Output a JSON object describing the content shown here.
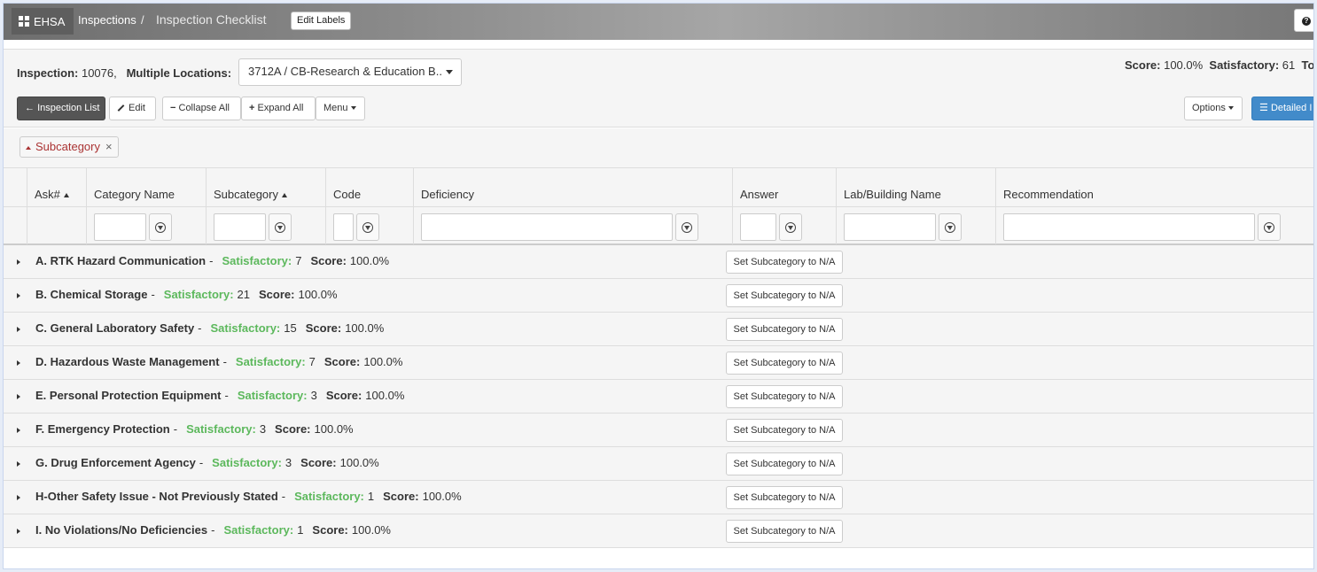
{
  "nav": {
    "brand": "EHSA",
    "breadcrumb_link": "Inspections",
    "breadcrumb_sep": "/",
    "breadcrumb_current": "Inspection Checklist",
    "edit_labels": "Edit Labels",
    "help_icon": "question-circle-icon"
  },
  "header": {
    "inspection_label": "Inspection:",
    "inspection_id": "10076,",
    "locations_label": "Multiple Locations:",
    "location_value": "3712A / CB-Research & Education B..",
    "score_label": "Score:",
    "score_value": "100.0%",
    "satisfactory_label": "Satisfactory:",
    "satisfactory_value": "61",
    "total_label": "Tot"
  },
  "toolbar": {
    "inspection_list": "Inspection List",
    "edit": "Edit",
    "collapse_all": "Collapse All",
    "expand_all": "Expand All",
    "menu": "Menu",
    "options": "Options",
    "detailed": "Detailed I"
  },
  "grouping": {
    "chip_label": "Subcategory",
    "remove": "×"
  },
  "columns": {
    "ask": "Ask#",
    "category": "Category Name",
    "subcategory": "Subcategory",
    "code": "Code",
    "deficiency": "Deficiency",
    "answer": "Answer",
    "lab": "Lab/Building Name",
    "recommendation": "Recommendation"
  },
  "groups": [
    {
      "name": "A. RTK Hazard Communication",
      "sat_label": "Satisfactory:",
      "sat": "7",
      "score_label": "Score:",
      "score": "100.0%",
      "button": "Set Subcategory to N/A"
    },
    {
      "name": "B. Chemical Storage",
      "sat_label": "Satisfactory:",
      "sat": "21",
      "score_label": "Score:",
      "score": "100.0%",
      "button": "Set Subcategory to N/A"
    },
    {
      "name": "C. General Laboratory Safety",
      "sat_label": "Satisfactory:",
      "sat": "15",
      "score_label": "Score:",
      "score": "100.0%",
      "button": "Set Subcategory to N/A"
    },
    {
      "name": "D. Hazardous Waste Management",
      "sat_label": "Satisfactory:",
      "sat": "7",
      "score_label": "Score:",
      "score": "100.0%",
      "button": "Set Subcategory to N/A"
    },
    {
      "name": "E. Personal Protection Equipment",
      "sat_label": "Satisfactory:",
      "sat": "3",
      "score_label": "Score:",
      "score": "100.0%",
      "button": "Set Subcategory to N/A"
    },
    {
      "name": "F. Emergency Protection",
      "sat_label": "Satisfactory:",
      "sat": "3",
      "score_label": "Score:",
      "score": "100.0%",
      "button": "Set Subcategory to N/A"
    },
    {
      "name": "G. Drug Enforcement Agency",
      "sat_label": "Satisfactory:",
      "sat": "3",
      "score_label": "Score:",
      "score": "100.0%",
      "button": "Set Subcategory to N/A"
    },
    {
      "name": "H-Other Safety Issue - Not Previously Stated",
      "sat_label": "Satisfactory:",
      "sat": "1",
      "score_label": "Score:",
      "score": "100.0%",
      "button": "Set Subcategory to N/A"
    },
    {
      "name": "I. No Violations/No Deficiencies",
      "sat_label": "Satisfactory:",
      "sat": "1",
      "score_label": "Score:",
      "score": "100.0%",
      "button": "Set Subcategory to N/A"
    }
  ],
  "colors": {
    "satisfactory": "#5cb85c",
    "chip_text": "#aa3333",
    "primary": "#428bca",
    "dark_button": "#555555"
  }
}
